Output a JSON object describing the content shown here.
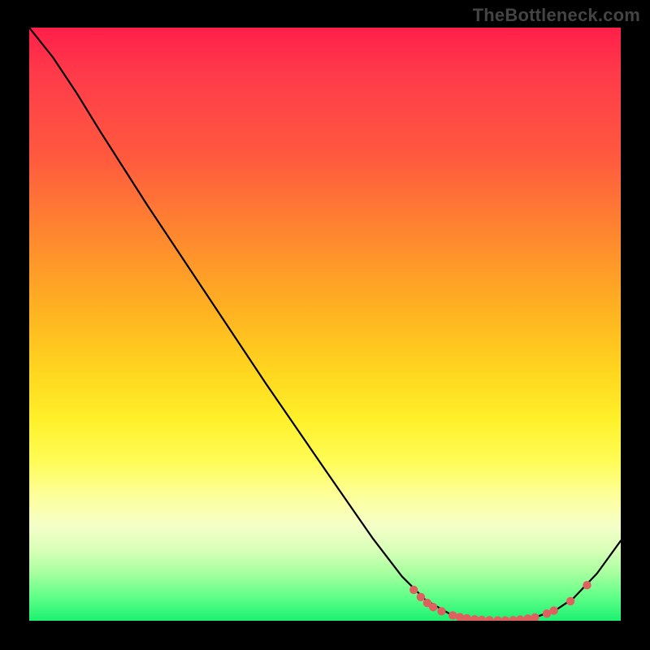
{
  "watermark": "TheBottleneck.com",
  "chart_data": {
    "type": "line",
    "title": "",
    "xlabel": "",
    "ylabel": "",
    "xlim": [
      0,
      100
    ],
    "ylim": [
      0,
      100
    ],
    "grid": false,
    "legend": false,
    "background_gradient": {
      "stops": [
        {
          "pos": 0,
          "color": "#ff1f4a"
        },
        {
          "pos": 36,
          "color": "#ff8b2e"
        },
        {
          "pos": 58,
          "color": "#ffd61f"
        },
        {
          "pos": 79,
          "color": "#fdff9b"
        },
        {
          "pos": 100,
          "color": "#1cf170"
        }
      ]
    },
    "curve": [
      {
        "x": 0.0,
        "y": 100.0
      },
      {
        "x": 4.0,
        "y": 95.0
      },
      {
        "x": 8.0,
        "y": 89.0
      },
      {
        "x": 12.0,
        "y": 82.5
      },
      {
        "x": 20.0,
        "y": 70.0
      },
      {
        "x": 30.0,
        "y": 55.0
      },
      {
        "x": 40.0,
        "y": 40.0
      },
      {
        "x": 50.0,
        "y": 25.5
      },
      {
        "x": 58.0,
        "y": 14.0
      },
      {
        "x": 63.0,
        "y": 7.5
      },
      {
        "x": 67.0,
        "y": 3.5
      },
      {
        "x": 71.0,
        "y": 1.2
      },
      {
        "x": 75.0,
        "y": 0.2
      },
      {
        "x": 80.0,
        "y": 0.0
      },
      {
        "x": 85.0,
        "y": 0.4
      },
      {
        "x": 89.0,
        "y": 1.8
      },
      {
        "x": 92.0,
        "y": 3.8
      },
      {
        "x": 96.0,
        "y": 8.0
      },
      {
        "x": 100.0,
        "y": 13.5
      }
    ],
    "highlight_points": [
      {
        "x": 65.0,
        "y": 5.2
      },
      {
        "x": 66.2,
        "y": 4.0
      },
      {
        "x": 67.3,
        "y": 3.0
      },
      {
        "x": 68.3,
        "y": 2.3
      },
      {
        "x": 69.7,
        "y": 1.6
      },
      {
        "x": 71.6,
        "y": 0.9
      },
      {
        "x": 72.8,
        "y": 0.6
      },
      {
        "x": 74.0,
        "y": 0.4
      },
      {
        "x": 75.3,
        "y": 0.25
      },
      {
        "x": 76.5,
        "y": 0.15
      },
      {
        "x": 77.8,
        "y": 0.1
      },
      {
        "x": 79.2,
        "y": 0.05
      },
      {
        "x": 80.5,
        "y": 0.05
      },
      {
        "x": 81.8,
        "y": 0.1
      },
      {
        "x": 83.0,
        "y": 0.2
      },
      {
        "x": 84.3,
        "y": 0.35
      },
      {
        "x": 85.5,
        "y": 0.55
      },
      {
        "x": 87.5,
        "y": 1.2
      },
      {
        "x": 88.7,
        "y": 1.7
      },
      {
        "x": 91.5,
        "y": 3.3
      },
      {
        "x": 94.3,
        "y": 6.0
      }
    ],
    "highlight_point_color": "#e0605f"
  }
}
